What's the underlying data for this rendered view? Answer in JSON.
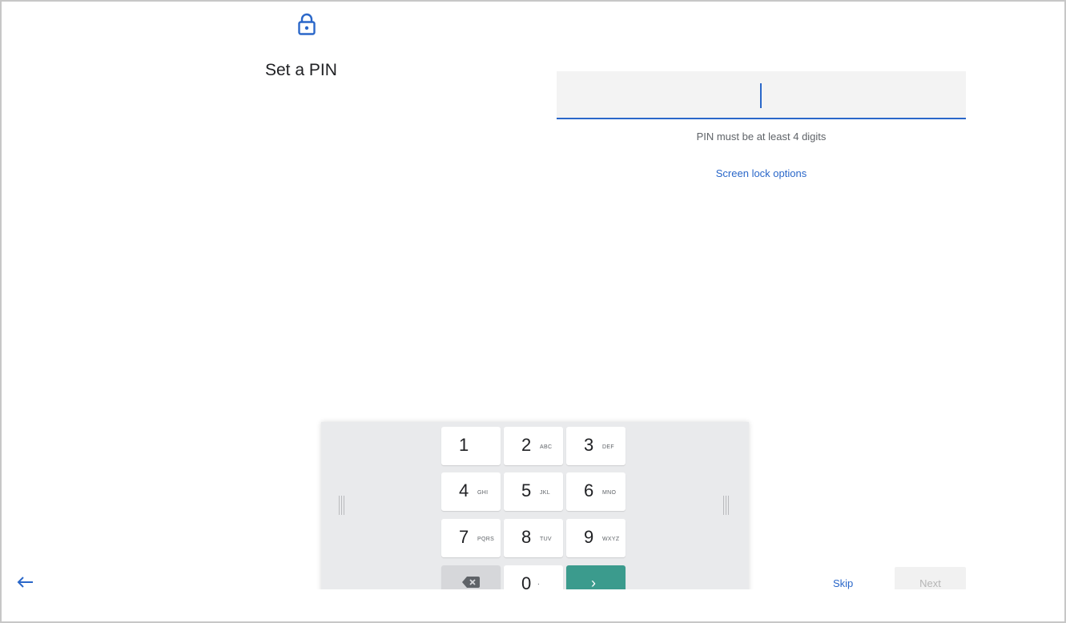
{
  "page": {
    "title": "Set a PIN",
    "icon": "lock-icon",
    "accent_color": "#2a67c9"
  },
  "pin_input": {
    "value": "",
    "hint": "PIN must be at least 4 digits"
  },
  "links": {
    "screen_lock_options": "Screen lock options"
  },
  "keypad": {
    "keys": [
      {
        "digit": "1",
        "letters": ""
      },
      {
        "digit": "2",
        "letters": "ABC"
      },
      {
        "digit": "3",
        "letters": "DEF"
      },
      {
        "digit": "4",
        "letters": "GHI"
      },
      {
        "digit": "5",
        "letters": "JKL"
      },
      {
        "digit": "6",
        "letters": "MNO"
      },
      {
        "digit": "7",
        "letters": "PQRS"
      },
      {
        "digit": "8",
        "letters": "TUV"
      },
      {
        "digit": "9",
        "letters": "WXYZ"
      }
    ],
    "zero": {
      "digit": "0",
      "letters": "."
    },
    "backspace_icon": "backspace-icon",
    "go_icon": "chevron-right-icon",
    "go_glyph": "›",
    "go_color": "#3b9b8d"
  },
  "footer": {
    "back_icon": "arrow-left-icon",
    "skip_label": "Skip",
    "next_label": "Next"
  }
}
